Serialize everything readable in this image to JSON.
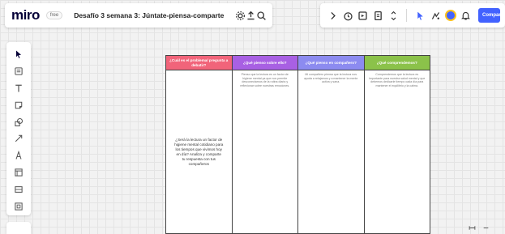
{
  "header": {
    "logo": "miro",
    "plan_badge": "free",
    "board_title": "Desafío 3 semana 3: Júntate-piensa-comparte",
    "share_label": "Compartir"
  },
  "colors": {
    "col_1": "#f1647a",
    "col_2": "#a860e3",
    "col_3": "#8c8bf0",
    "col_4": "#8bc24a",
    "accent": "#4262ff"
  },
  "board": {
    "columns": [
      {
        "header": "¿Cuál es el problema/ pregunta a debatir?",
        "body": "¿Será la lectura un factor de higiene mental cotidiano para los tiempos que vivimos hoy en día? Analiza y comparte tu respuesta con tus compañeros"
      },
      {
        "header": "¿Qué pienso sobre ello?",
        "body": "Pienso que la lectura es un factor de higiene mental ya que nos permite desconectarnos de la rutina diaria y reflexionar sobre nuestras emociones."
      },
      {
        "header": "¿Qué pienso en compañero?",
        "body": "Mi compañero piensa que la lectura nos ayuda a relajarnos y a mantener la mente activa y sana."
      },
      {
        "header": "¿Qué comprendemos?",
        "body": "Comprendemos que la lectura es importante para nuestra salud mental y que debemos dedicarle tiempo cada día para mantener el equilibrio y la calma."
      }
    ]
  }
}
